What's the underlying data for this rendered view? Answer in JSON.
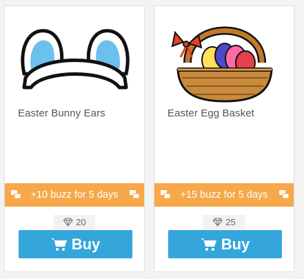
{
  "items": [
    {
      "title": "Easter Bunny Ears",
      "image_icon": "bunny-ears-icon",
      "buzz_text": "+10 buzz for 5 days",
      "price": "20",
      "buy_label": "Buy"
    },
    {
      "title": "Easter Egg Basket",
      "image_icon": "egg-basket-icon",
      "buzz_text": "+15 buzz for 5 days",
      "price": "25",
      "buy_label": "Buy"
    }
  ],
  "colors": {
    "buzz_bar": "#f7a84a",
    "buy_button": "#34a6dc",
    "card_bg": "#ffffff",
    "page_bg": "#f3f3f3"
  }
}
